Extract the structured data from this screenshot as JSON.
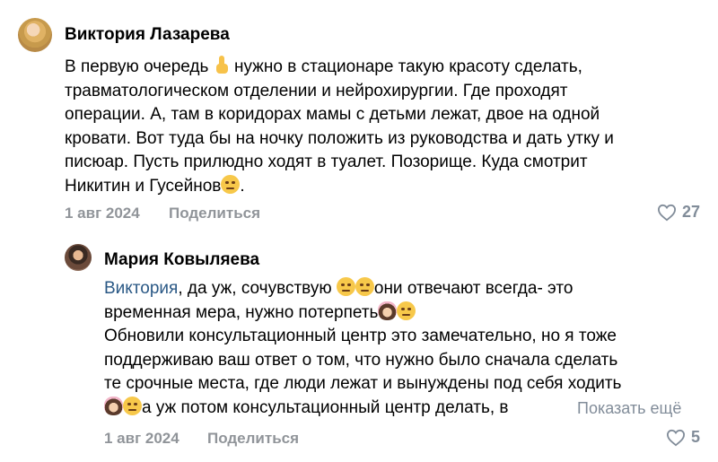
{
  "comments": [
    {
      "author": "Виктория Лазарева",
      "lines": [
        {
          "a": "В первую очередь ",
          "b": " нужно в стационаре такую красоту сделать,"
        },
        {
          "a": "травматологическом отделении и нейрохирургии. Где проходят"
        },
        {
          "a": "операции. А, там в коридорах мамы с детьми лежат, двое на одной"
        },
        {
          "a": "кровати. Вот туда бы на ночку положить из руководства и дать утку и"
        },
        {
          "a": "писюар. Пусть прилюдно ходят в туалет. Позорище. Куда смотрит"
        },
        {
          "a": "Никитин и Гусейнов",
          "b": "."
        }
      ],
      "emojis": [
        "pointing-up-emoji",
        "slightly-frowning-face-emoji"
      ],
      "date": "1 авг 2024",
      "share_label": "Поделиться",
      "likes": "27"
    },
    {
      "author": "Мария Ковыляева",
      "mention": "Виктория",
      "lines": [
        {
          "a": ", да уж, сочувствую ",
          "b": "они отвечают всегда- это"
        },
        {
          "a": "временная мера, нужно потерпеть"
        },
        {
          "a": "Обновили консультационный центр это замечательно, но я тоже"
        },
        {
          "a": "поддерживаю ваш ответ о том, что нужно было сначала сделать"
        },
        {
          "a": "те срочные места, где люди лежат и вынуждены под себя ходить"
        },
        {
          "a": "а уж потом консультационный центр делать, в"
        }
      ],
      "emojis": [
        "rolling-eyes-emoji",
        "disappointed-face-emoji",
        "woman-facepalming-emoji"
      ],
      "show_more": "Показать ещё",
      "date": "1 авг 2024",
      "share_label": "Поделиться",
      "likes": "5"
    }
  ]
}
